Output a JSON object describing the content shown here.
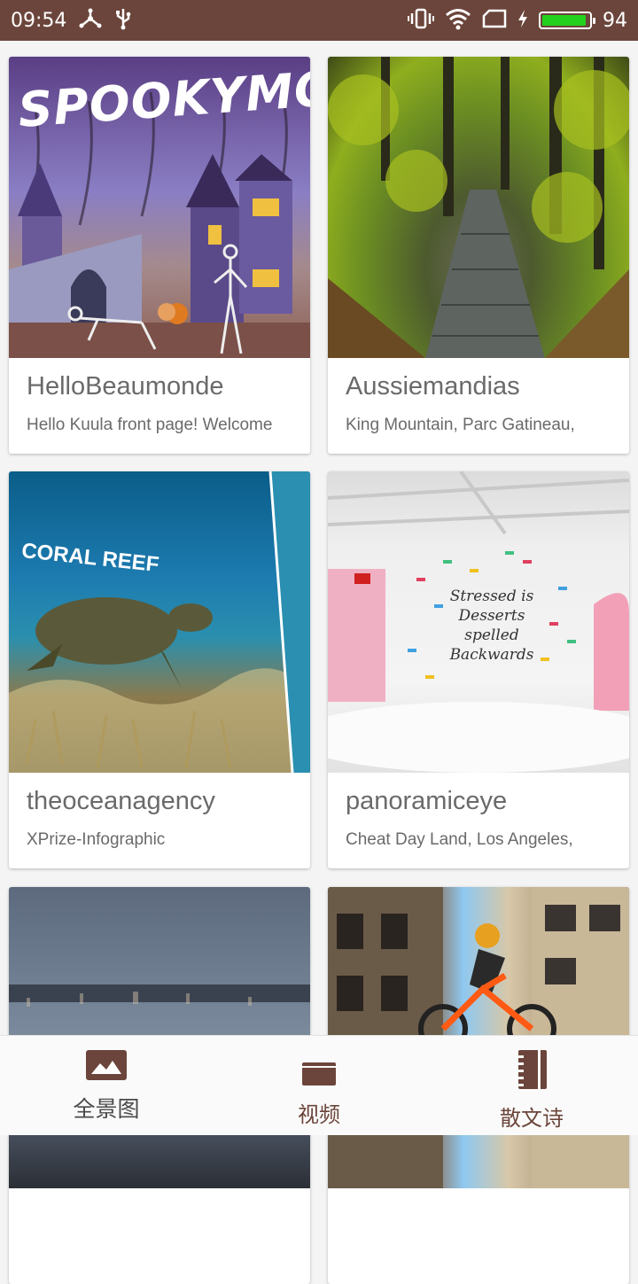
{
  "status_bar": {
    "time": "09:54",
    "battery_level": "94",
    "battery_fraction": 0.94,
    "accent": "#6b453b",
    "battery_color": "#22d11e",
    "icons": [
      "usb-debug-icon",
      "usb-icon",
      "vibrate-icon",
      "wifi-icon",
      "sim-icon",
      "charging-icon",
      "battery-icon"
    ]
  },
  "cards": [
    {
      "title": "HelloBeaumonde",
      "subtitle": "Hello Kuula front page! Welcome",
      "image_text": "SPOOKYMONDE"
    },
    {
      "title": "Aussiemandias",
      "subtitle": "King Mountain, Parc Gatineau,"
    },
    {
      "title": "theoceanagency",
      "subtitle": "XPrize-Infographic",
      "image_text": "CORAL REEF"
    },
    {
      "title": "panoramiceye",
      "subtitle": "Cheat Day Land, Los Angeles,",
      "image_text": "Stressed is Desserts spelled Backwards"
    },
    {
      "title": "",
      "subtitle": ""
    },
    {
      "title": "",
      "subtitle": ""
    }
  ],
  "bottom_nav": {
    "items": [
      {
        "label": "全景图",
        "icon": "panorama-image-icon",
        "active": true
      },
      {
        "label": "视频",
        "icon": "video-icon",
        "active": false
      },
      {
        "label": "散文诗",
        "icon": "notebook-icon",
        "active": false
      }
    ],
    "active_color": "#4a4a4a",
    "inactive_color": "#6b453b"
  }
}
